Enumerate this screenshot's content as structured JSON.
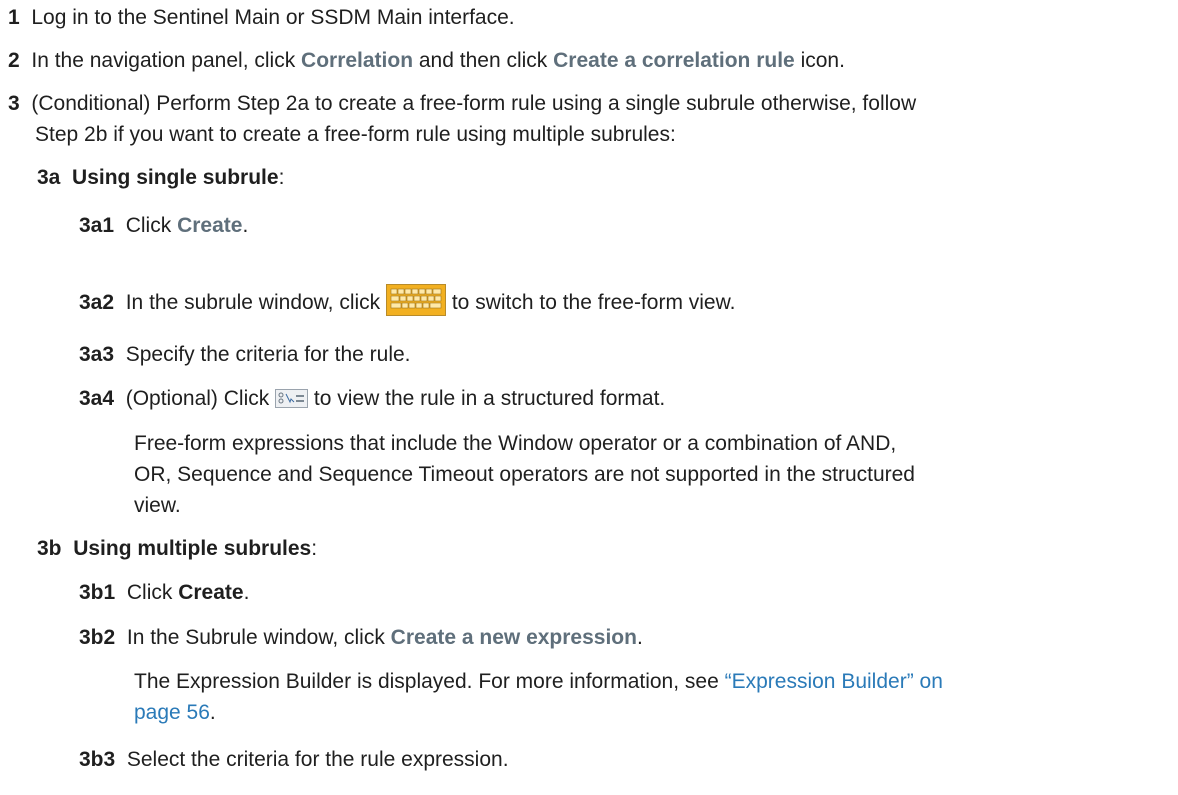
{
  "steps": [
    {
      "num": "1",
      "text": "Log in to the Sentinel Main or SSDM Main interface."
    },
    {
      "num": "2",
      "pre": "In the navigation panel, click ",
      "ui1": "Correlation",
      "mid": " and then click ",
      "ui2": "Create a correlation rule",
      "post": " icon."
    },
    {
      "num": "3",
      "line1": "(Conditional) Perform Step 2a to create a free-form rule using a single subrule otherwise, follow",
      "line2": "Step 2b if you want to create a free-form rule using multiple subrules:"
    }
  ],
  "sub_a": {
    "num": "3a",
    "label": "Using single subrule",
    "suffix": ":",
    "items": [
      {
        "num": "3a1",
        "pre": "Click ",
        "ui": "Create",
        "post": "."
      },
      {
        "num": "3a2",
        "pre": "In the subrule window, click ",
        "icon": "keyboard-icon",
        "post": " to switch to the free-form view."
      },
      {
        "num": "3a3",
        "text": "Specify the criteria for the rule."
      },
      {
        "num": "3a4",
        "pre": "(Optional) Click ",
        "icon": "structured-view-icon",
        "post": " to view the rule in a structured format.",
        "note": [
          "Free-form expressions that include the Window operator or a combination of AND,",
          "OR, Sequence and Sequence Timeout operators are not supported in the structured",
          "view."
        ]
      }
    ]
  },
  "sub_b": {
    "num": "3b",
    "label": "Using multiple subrules",
    "suffix": ":",
    "items": [
      {
        "num": "3b1",
        "pre": "Click ",
        "bold": "Create",
        "post": "."
      },
      {
        "num": "3b2",
        "pre": "In the Subrule window, click ",
        "ui": "Create a new expression",
        "post": ".",
        "note_pre": "The Expression Builder is displayed. For more information, see ",
        "link1": "“Expression Builder” on",
        "link2": "page 56",
        "note_post": "."
      },
      {
        "num": "3b3",
        "text": "Select the criteria for the rule expression."
      }
    ]
  },
  "colors": {
    "text": "#1f1f1f",
    "ui_label": "#5f6f7b",
    "link": "#2a7ab8",
    "icon_orange": "#f2b021"
  }
}
